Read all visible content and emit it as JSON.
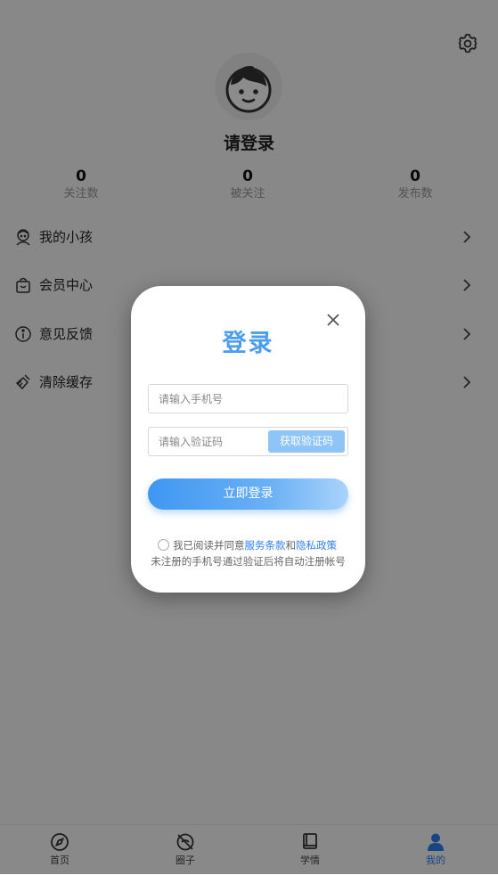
{
  "profile": {
    "login_prompt": "请登录",
    "stats": [
      {
        "value": "0",
        "label": "关注数"
      },
      {
        "value": "0",
        "label": "被关注"
      },
      {
        "value": "0",
        "label": "发布数"
      }
    ]
  },
  "menu": [
    {
      "label": "我的小孩",
      "icon": "child-icon"
    },
    {
      "label": "会员中心",
      "icon": "member-bag-icon"
    },
    {
      "label": "意见反馈",
      "icon": "info-icon"
    },
    {
      "label": "清除缓存",
      "icon": "broom-icon"
    }
  ],
  "tabbar": [
    {
      "label": "首页",
      "icon": "compass-icon",
      "active": false
    },
    {
      "label": "圈子",
      "icon": "circle-icon",
      "active": false
    },
    {
      "label": "学情",
      "icon": "book-icon",
      "active": false
    },
    {
      "label": "我的",
      "icon": "person-icon",
      "active": true
    }
  ],
  "modal": {
    "title": "登录",
    "phone_placeholder": "请输入手机号",
    "code_placeholder": "请输入验证码",
    "get_code_label": "获取验证码",
    "login_label": "立即登录",
    "agree_prefix": "我已阅读并同意",
    "terms_link": "服务条款",
    "and_text": "和",
    "privacy_link": "隐私政策",
    "note": "未注册的手机号通过验证后将自动注册帐号"
  },
  "colors": {
    "accent": "#2f7ff0",
    "title_blue": "#4a9df0",
    "button_light": "#8ec4f6"
  }
}
